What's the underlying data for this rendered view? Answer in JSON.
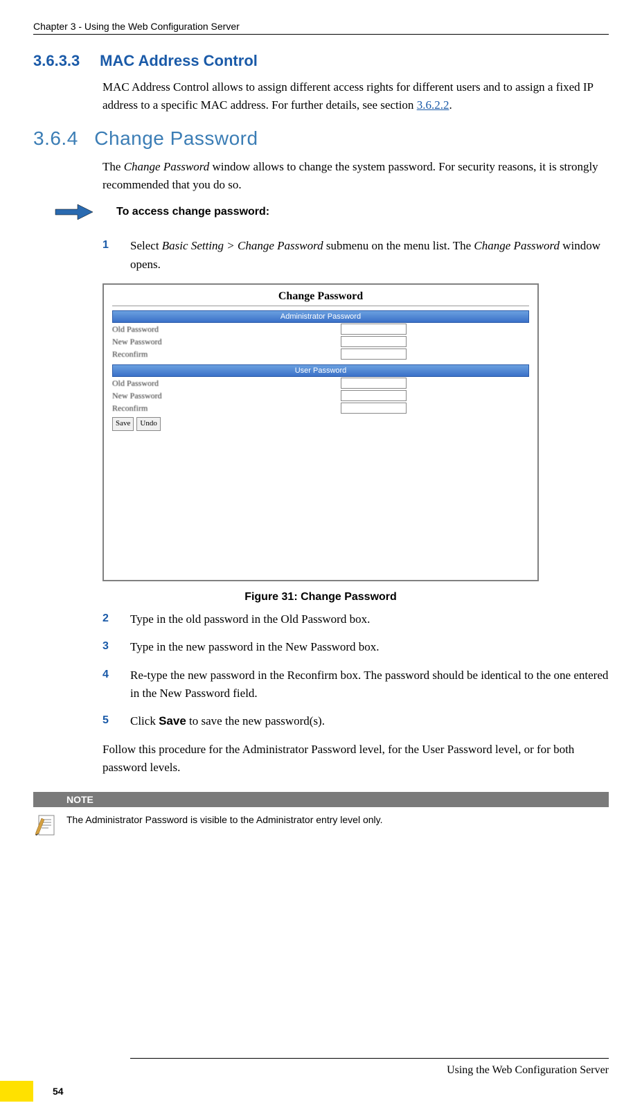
{
  "header": "Chapter 3 - Using the Web Configuration Server",
  "s36333": {
    "num": "3.6.3.3",
    "title": "MAC Address Control",
    "body_before": "MAC Address Control allows to assign different access rights for different users and to assign a fixed IP address to a specific MAC address. For further details, see section ",
    "link": "3.6.2.2",
    "body_after": "."
  },
  "s364": {
    "num": "3.6.4",
    "title": "Change Password",
    "intro_before": "The ",
    "intro_italic": "Change Password",
    "intro_after": " window allows to change the system password. For security reasons, it is strongly recommended that you do so.",
    "access_label": "To access change password:"
  },
  "steps": {
    "s1_num": "1",
    "s1_a": "Select ",
    "s1_b": "Basic Setting > Change Password",
    "s1_c": " submenu on the menu list. The ",
    "s1_d": "Change Password ",
    "s1_e": " window opens.",
    "s2_num": "2",
    "s2": "Type in the old password in the Old Password box.",
    "s3_num": "3",
    "s3": "Type in the new password in the New Password box.",
    "s4_num": "4",
    "s4": "Re-type the new password in the Reconfirm box. The password should be identical to the one entered in the New Password field.",
    "s5_num": "5",
    "s5_a": "Click ",
    "s5_b": "Save",
    "s5_c": " to save the new password(s).",
    "followup": "Follow this procedure for the Administrator Password level, for the User Password level, or for both password levels."
  },
  "screenshot": {
    "title": "Change Password",
    "admin_header": "Administrator Password",
    "user_header": "User Password",
    "old_pw": "Old Password",
    "new_pw": "New Password",
    "reconfirm": "Reconfirm",
    "save": "Save",
    "undo": "Undo"
  },
  "figure_caption": "Figure 31: Change Password",
  "note": {
    "label": "NOTE",
    "text": "The Administrator Password is visible to the Administrator entry level only."
  },
  "footer": {
    "text": "Using the Web Configuration Server",
    "page": "54"
  }
}
